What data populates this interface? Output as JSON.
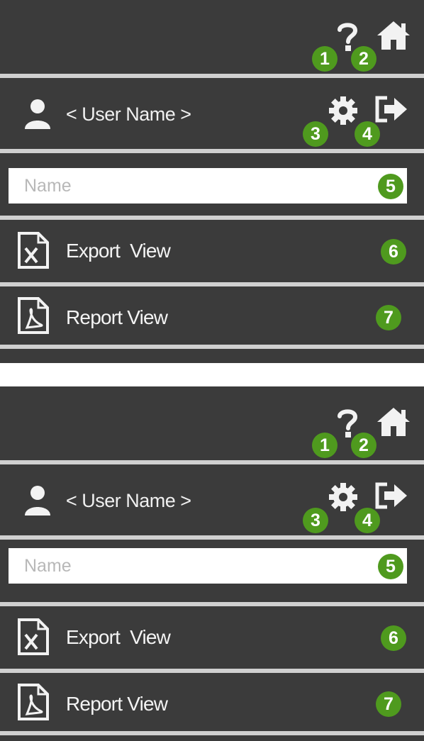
{
  "panels": [
    {
      "user": {
        "name_label": "< User Name >"
      },
      "search": {
        "placeholder": "Name"
      },
      "rows": [
        {
          "label": "Export  View",
          "icon": "excel-file-icon"
        },
        {
          "label": "Report View",
          "icon": "pdf-file-icon"
        }
      ],
      "badges": [
        "1",
        "2",
        "3",
        "4",
        "5",
        "6",
        "7"
      ]
    },
    {
      "user": {
        "name_label": "< User Name >"
      },
      "search": {
        "placeholder": "Name"
      },
      "rows": [
        {
          "label": "Export  View",
          "icon": "excel-file-icon"
        },
        {
          "label": "Report View",
          "icon": "pdf-file-icon"
        }
      ],
      "badges": [
        "1",
        "2",
        "3",
        "4",
        "5",
        "6",
        "7"
      ]
    }
  ],
  "icons": {
    "help": "question-mark-icon",
    "home": "home-icon",
    "user": "user-icon",
    "settings": "gear-icon",
    "logout": "logout-icon"
  },
  "colors": {
    "bar": "#3b3b3b",
    "separator": "#d0d0d0",
    "badge": "#4f9a1e",
    "input_bg": "#ffffff",
    "placeholder": "#b8b8b8"
  }
}
